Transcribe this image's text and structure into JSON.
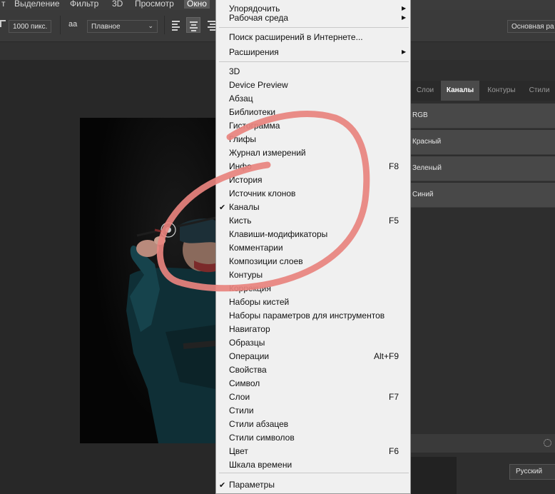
{
  "menubar": {
    "items": [
      "т",
      "Выделение",
      "Фильтр",
      "3D",
      "Просмотр",
      "Окно"
    ]
  },
  "options": {
    "size_value": "1000 пикс.",
    "aa_icon_text": "aа",
    "antialias_value": "Плавное",
    "workspace_value": "Основная ра"
  },
  "panel": {
    "tabs": [
      "Слои",
      "Каналы",
      "Контуры",
      "Стили"
    ],
    "active_tab": "Каналы",
    "channels": [
      "RGB",
      "Красный",
      "Зеленый",
      "Синий"
    ]
  },
  "status": {
    "language": "Русский"
  },
  "window_menu": {
    "top_items": [
      "Упорядочить",
      "Рабочая среда"
    ],
    "ext_items": [
      "Поиск расширений в Интернете...",
      "Расширения"
    ],
    "panels": [
      {
        "label": "3D",
        "shortcut": ""
      },
      {
        "label": "Device Preview",
        "shortcut": ""
      },
      {
        "label": "Абзац",
        "shortcut": ""
      },
      {
        "label": "Библиотеки",
        "shortcut": ""
      },
      {
        "label": "Гистограмма",
        "shortcut": ""
      },
      {
        "label": "Глифы",
        "shortcut": ""
      },
      {
        "label": "Журнал измерений",
        "shortcut": ""
      },
      {
        "label": "Инфо",
        "shortcut": "F8"
      },
      {
        "label": "История",
        "shortcut": ""
      },
      {
        "label": "Источник клонов",
        "shortcut": ""
      },
      {
        "label": "Каналы",
        "shortcut": "",
        "checked": true
      },
      {
        "label": "Кисть",
        "shortcut": "F5"
      },
      {
        "label": "Клавиши-модификаторы",
        "shortcut": ""
      },
      {
        "label": "Комментарии",
        "shortcut": ""
      },
      {
        "label": "Композиции слоев",
        "shortcut": ""
      },
      {
        "label": "Контуры",
        "shortcut": ""
      },
      {
        "label": "Коррекция",
        "shortcut": ""
      },
      {
        "label": "Наборы кистей",
        "shortcut": ""
      },
      {
        "label": "Наборы параметров для инструментов",
        "shortcut": ""
      },
      {
        "label": "Навигатор",
        "shortcut": ""
      },
      {
        "label": "Образцы",
        "shortcut": ""
      },
      {
        "label": "Операции",
        "shortcut": "Alt+F9"
      },
      {
        "label": "Свойства",
        "shortcut": ""
      },
      {
        "label": "Символ",
        "shortcut": ""
      },
      {
        "label": "Слои",
        "shortcut": "F7"
      },
      {
        "label": "Стили",
        "shortcut": ""
      },
      {
        "label": "Стили абзацев",
        "shortcut": ""
      },
      {
        "label": "Стили символов",
        "shortcut": ""
      },
      {
        "label": "Цвет",
        "shortcut": "F6"
      },
      {
        "label": "Шкала времени",
        "shortcut": ""
      }
    ],
    "bottom_items": [
      {
        "label": "Параметры",
        "checked": true
      }
    ]
  },
  "colors": {
    "annotation": "#e8837e",
    "menu_bg": "#f0f0f0",
    "app_bg": "#282828",
    "panel_active_bg": "#484848"
  }
}
